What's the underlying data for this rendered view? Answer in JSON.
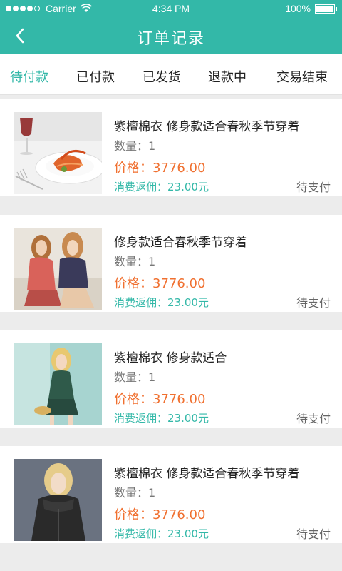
{
  "status_bar": {
    "carrier": "Carrier",
    "time": "4:34 PM",
    "battery": "100%"
  },
  "nav": {
    "title": "订单记录",
    "back_icon": "chevron-left-icon"
  },
  "tabs": [
    {
      "label": "待付款",
      "active": true
    },
    {
      "label": "已付款",
      "active": false
    },
    {
      "label": "已发货",
      "active": false
    },
    {
      "label": "退款中",
      "active": false
    },
    {
      "label": "交易结束",
      "active": false
    }
  ],
  "orders": [
    {
      "name": "紫檀棉衣 修身款适合春秋季节穿着",
      "qty_label": "数量：",
      "qty": "1",
      "price_label": "价格：",
      "price": "3776.00",
      "rebate_label": "消费返佣：",
      "rebate": "23.00元",
      "status": "待支付",
      "image": "food-plate-image"
    },
    {
      "name": "修身款适合春秋季节穿着",
      "qty_label": "数量：",
      "qty": "1",
      "price_label": "价格：",
      "price": "3776.00",
      "rebate_label": "消费返佣：",
      "rebate": "23.00元",
      "status": "待支付",
      "image": "two-models-image"
    },
    {
      "name": "紫檀棉衣 修身款适合",
      "qty_label": "数量：",
      "qty": "1",
      "price_label": "价格：",
      "price": "3776.00",
      "rebate_label": "消费返佣：",
      "rebate": "23.00元",
      "status": "待支付",
      "image": "model-green-dress-image"
    },
    {
      "name": "紫檀棉衣 修身款适合春秋季节穿着",
      "qty_label": "数量：",
      "qty": "1",
      "price_label": "价格：",
      "price": "3776.00",
      "rebate_label": "消费返佣：",
      "rebate": "23.00元",
      "status": "待支付",
      "image": "model-leather-jacket-image"
    }
  ],
  "colors": {
    "accent": "#33b8a8",
    "price": "#f07030",
    "background": "#ececec"
  }
}
